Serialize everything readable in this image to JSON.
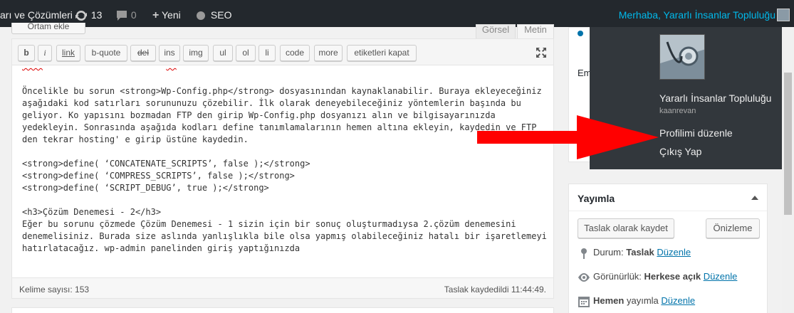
{
  "adminbar": {
    "site_title": "arı ve Çözümleri",
    "updates_count": "13",
    "comments_count": "0",
    "new_label": "Yeni",
    "seo_label": "SEO",
    "greeting": "Merhaba, Yararlı İnsanlar Topluluğu"
  },
  "editor": {
    "add_media_label": "Ortam ekle",
    "tab_visual": "Görsel",
    "tab_text": "Metin",
    "buttons": [
      "b",
      "i",
      "link",
      "b-quote",
      "del",
      "ins",
      "img",
      "ul",
      "ol",
      "li",
      "code",
      "more",
      "etiketleri kapat"
    ],
    "lines": [
      "Öncelikle bu sorun <strong>Wp-Config.php</strong> dosyasınından kaynaklanabilir. Buraya ekleyeceğiniz",
      "aşağıdaki kod satırları sorununuzu çözebilir. İlk olarak deneyebileceğiniz yöntemlerin başında bu",
      "geliyor. Ko yapısını bozmadan FTP den girip Wp-Config.php dosyanızı alın ve bilgisayarınızda",
      "yedekleyin. Sonrasında aşağıda kodları define tanımlamalarının hemen altına ekleyin, kaydedin ve FTP",
      "den tekrar hosting' e girip üstüne kaydedin.",
      "",
      "<strong>define( ‘CONCATENATE_SCRIPTS’, false );</strong>",
      "<strong>define( ‘COMPRESS_SCRIPTS’, false );</strong>",
      "<strong>define( ‘SCRIPT_DEBUG’, true );</strong>",
      "",
      "<h3>Çözüm Denemesi - 2</h3>",
      "Eğer bu sorunu çözmede Çözüm Denemesi - 1 sizin için bir sonuç oluşturmadıysa 2.çözüm denemesini",
      "denemelisiniz. Burada size aslında yanlışlıkla bile olsa yapmış olabileceğiniz hatalı bir işaretlemeyi",
      "hatırlatacağız. wp-admin panelinden giriş yaptığınızda"
    ],
    "word_count": "Kelime sayısı: 153",
    "autosave": "Taslak kaydedildi 11:44:49."
  },
  "sidebar": {
    "em_text": "Em"
  },
  "user_menu": {
    "display_name": "Yararlı İnsanlar Topluluğu",
    "username": "kaanrevan",
    "edit_profile": "Profilimi düzenle",
    "logout": "Çıkış Yap"
  },
  "publish": {
    "title": "Yayımla",
    "save_draft": "Taslak olarak kaydet",
    "preview": "Önizleme",
    "status_label": "Durum: ",
    "status_value": "Taslak",
    "visibility_label": "Görünürlük: ",
    "visibility_value": "Herkese açık",
    "schedule_value": "Hemen",
    "schedule_label": " yayımla",
    "edit_link": "Düzenle"
  },
  "colors": {
    "adminbar_bg": "#23282d",
    "dropdown_bg": "#32373c",
    "link_blue": "#0073aa",
    "highlight": "#00b9eb",
    "annotation_red": "#ff0000"
  }
}
